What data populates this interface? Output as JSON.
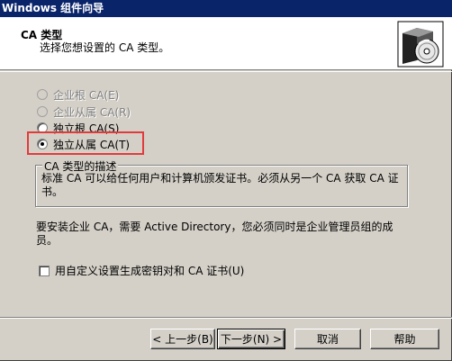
{
  "window": {
    "title": "Windows 组件向导"
  },
  "header": {
    "title": "CA 类型",
    "subtitle": "选择您想设置的 CA 类型。",
    "icon": "cd-setup-box-icon"
  },
  "ca_types": {
    "options": [
      {
        "label": "企业根 CA(E)",
        "enabled": false,
        "selected": false
      },
      {
        "label": "企业从属 CA(R)",
        "enabled": false,
        "selected": false
      },
      {
        "label": "独立根 CA(S)",
        "enabled": true,
        "selected": false
      },
      {
        "label": "独立从属 CA(T)",
        "enabled": true,
        "selected": true
      }
    ]
  },
  "description": {
    "legend": "CA 类型的描述",
    "text": "标准 CA 可以给任何用户和计算机颁发证书。必须从另一个 CA 获取 CA 证书。"
  },
  "info": "要安装企业 CA，需要 Active Directory，您必须同时是企业管理员组的成员。",
  "custom_keys": {
    "label": "用自定义设置生成密钥对和 CA 证书(U)",
    "checked": false
  },
  "buttons": {
    "back": "< 上一步(B)",
    "next": "下一步(N) >",
    "cancel": "取消",
    "help": "帮助"
  },
  "colors": {
    "title_bar": "#0a246a",
    "dialog_face": "#d4d0c8",
    "highlight_box": "#e23b3b"
  }
}
